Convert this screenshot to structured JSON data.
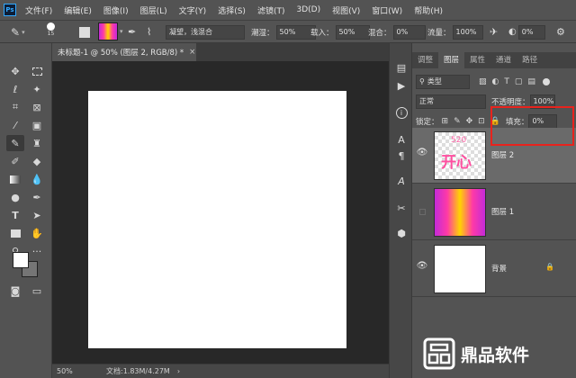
{
  "app": {
    "logo_text": "Ps"
  },
  "menu": [
    "文件(F)",
    "编辑(E)",
    "图像(I)",
    "图层(L)",
    "文字(Y)",
    "选择(S)",
    "滤镜(T)",
    "3D(D)",
    "视图(V)",
    "窗口(W)",
    "帮助(H)"
  ],
  "options": {
    "brush_size": "15",
    "blend_mode_value": "凝望，浅混合",
    "wet_label": "潮湿：",
    "wet_value": "50%",
    "load_label": "载入：",
    "load_value": "50%",
    "mix_label": "混合：",
    "mix_value": "0%",
    "flow_label": "流量：",
    "flow_value": "100%",
    "smooth_value": "0%"
  },
  "document": {
    "tab_title": "未标题-1 @ 50% (图层 2, RGB/8) *",
    "zoom": "50%",
    "doc_info": "文档:1.83M/4.27M"
  },
  "panel": {
    "tabs": [
      "调整",
      "图层",
      "属性",
      "通道",
      "路径"
    ],
    "active_tab": "图层",
    "filter_kind": "类型",
    "blend_mode": "正常",
    "opacity_label": "不透明度：",
    "opacity_value": "100%",
    "lock_label": "锁定：",
    "fill_label": "填充：",
    "fill_value": "0%",
    "fill_slider_fraction": 0.0,
    "layers": [
      {
        "name": "图层 2",
        "visible": true,
        "selected": true,
        "thumb_text_top": "520",
        "thumb_text_main": "开心"
      },
      {
        "name": "图层 1",
        "visible": false,
        "selected": false
      },
      {
        "name": "背景",
        "visible": true,
        "selected": false,
        "locked": true
      }
    ]
  },
  "watermark": {
    "text": "鼎品软件"
  },
  "colors": {
    "highlight": "#e8231d",
    "gradient": [
      "#c32ad8",
      "#ff3aa6",
      "#ffd400",
      "#ff3aa6",
      "#c32ad8"
    ]
  }
}
